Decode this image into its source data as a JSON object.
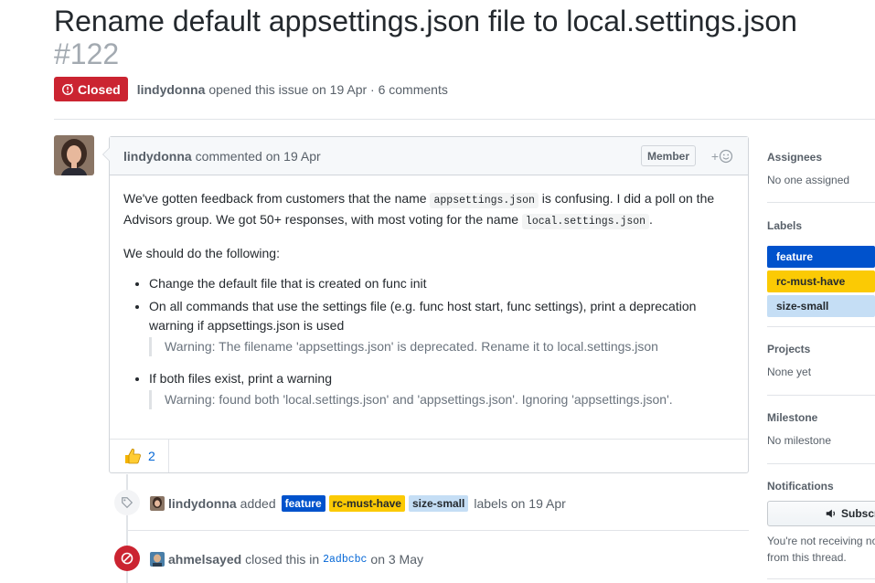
{
  "issue": {
    "title": "Rename default appsettings.json file to local.settings.json",
    "number": "#122",
    "state": "Closed",
    "author": "lindydonna",
    "meta_text": "opened this issue on 19 Apr · 6 comments"
  },
  "comment": {
    "author": "lindydonna",
    "action": "commented on 19 Apr",
    "role_badge": "Member",
    "add_reaction": "+",
    "p1_a": "We've gotten feedback from customers that the name ",
    "p1_code1": "appsettings.json",
    "p1_b": " is confusing. I did a poll on the Advisors group. We got 50+ responses, with most voting for the name ",
    "p1_code2": "local.settings.json",
    "p1_c": ".",
    "p2": "We should do the following:",
    "items": [
      {
        "text": "Change the default file that is created on func init",
        "quote": ""
      },
      {
        "text": "On all commands that use the settings file (e.g. func host start, func settings), print a deprecation warning if appsettings.json is used",
        "quote": "Warning: The filename 'appsettings.json' is deprecated. Rename it to local.settings.json"
      },
      {
        "text": "If both files exist, print a warning",
        "quote": "Warning: found both 'local.settings.json' and 'appsettings.json'. Ignoring 'appsettings.json'."
      }
    ],
    "reaction_count": "2"
  },
  "events": [
    {
      "user": "lindydonna",
      "verb": "added",
      "labels": [
        "feature",
        "rc-must-have",
        "size-small"
      ],
      "tail": "labels on 19 Apr"
    },
    {
      "user": "ahmelsayed",
      "verb": "closed this in",
      "commit": "2adbcbc",
      "tail": "on 3 May"
    }
  ],
  "sidebar": {
    "assignees_heading": "Assignees",
    "assignees_value": "No one assigned",
    "labels_heading": "Labels",
    "labels": [
      {
        "name": "feature",
        "bg": "#0052cc",
        "fg": "#ffffff"
      },
      {
        "name": "rc-must-have",
        "bg": "#fbca04",
        "fg": "#24292e"
      },
      {
        "name": "size-small",
        "bg": "#c5def5",
        "fg": "#24292e"
      }
    ],
    "projects_heading": "Projects",
    "projects_value": "None yet",
    "milestone_heading": "Milestone",
    "milestone_value": "No milestone",
    "notifications_heading": "Notifications",
    "subscribe_label": "Subscr",
    "notif_text": "You're not receiving no from this thread."
  },
  "colors": {
    "closed": "#cb2431",
    "link": "#0366d6"
  }
}
